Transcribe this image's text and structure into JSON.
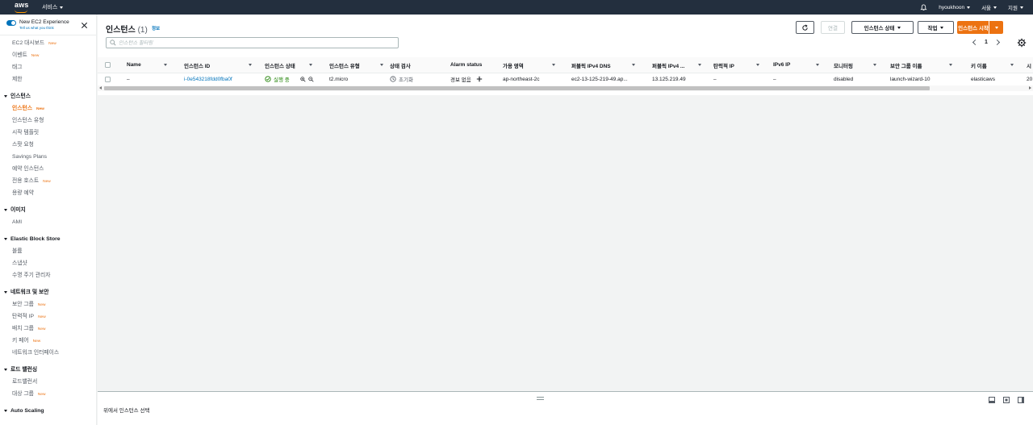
{
  "topnav": {
    "logo_text": "aws",
    "services_label": "서비스",
    "user_label": "hyoukhoon",
    "region_label": "서울",
    "support_label": "지원"
  },
  "sidebar": {
    "experience_title": "New EC2 Experience",
    "experience_sub": "Tell us what you think",
    "groups": [
      {
        "title": null,
        "items": [
          {
            "label": "EC2 대시보드",
            "new": "New",
            "active": false
          },
          {
            "label": "이벤트",
            "new": "New",
            "active": false
          },
          {
            "label": "태그",
            "new": null,
            "active": false
          },
          {
            "label": "제한",
            "new": null,
            "active": false
          }
        ]
      },
      {
        "title": "인스턴스",
        "items": [
          {
            "label": "인스턴스",
            "new": "New",
            "active": true
          },
          {
            "label": "인스턴스 유형",
            "new": null,
            "active": false
          },
          {
            "label": "시작 템플릿",
            "new": null,
            "active": false
          },
          {
            "label": "스팟 요청",
            "new": null,
            "active": false
          },
          {
            "label": "Savings Plans",
            "new": null,
            "active": false
          },
          {
            "label": "예약 인스턴스",
            "new": null,
            "active": false
          },
          {
            "label": "전용 호스트",
            "new": "New",
            "active": false
          },
          {
            "label": "용량 예약",
            "new": null,
            "active": false
          }
        ]
      },
      {
        "title": "이미지",
        "items": [
          {
            "label": "AMI",
            "new": null,
            "active": false
          }
        ]
      },
      {
        "title": "Elastic Block Store",
        "items": [
          {
            "label": "볼륨",
            "new": null,
            "active": false
          },
          {
            "label": "스냅샷",
            "new": null,
            "active": false
          },
          {
            "label": "수명 주기 관리자",
            "new": null,
            "active": false
          }
        ]
      },
      {
        "title": "네트워크 및 보안",
        "items": [
          {
            "label": "보안 그룹",
            "new": "New",
            "active": false
          },
          {
            "label": "탄력적 IP",
            "new": "New",
            "active": false
          },
          {
            "label": "배치 그룹",
            "new": "New",
            "active": false
          },
          {
            "label": "키 페어",
            "new": "New",
            "active": false
          },
          {
            "label": "네트워크 인터페이스",
            "new": null,
            "active": false
          }
        ]
      },
      {
        "title": "로드 밸런싱",
        "items": [
          {
            "label": "로드밸런서",
            "new": null,
            "active": false
          },
          {
            "label": "대상 그룹",
            "new": "New",
            "active": false
          }
        ]
      },
      {
        "title": "Auto Scaling",
        "items": []
      }
    ]
  },
  "main": {
    "title": "인스턴스",
    "count": "(1)",
    "info": "정보",
    "connect_label": "연결",
    "state_label": "인스턴스 상태",
    "actions_label": "작업",
    "launch_label": "인스턴스 시작",
    "search_placeholder": "인스턴스 필터링",
    "page": "1",
    "columns": [
      "Name",
      "인스턴스 ID",
      "인스턴스 상태",
      "인스턴스 유형",
      "상태 검사",
      "Alarm status",
      "가용 영역",
      "퍼블릭 IPv4 DNS",
      "퍼블릭 IPv4 ...",
      "탄력적 IP",
      "IPv6 IP",
      "모니터링",
      "보안 그룹 이름",
      "키 이름",
      "시"
    ],
    "row": {
      "name": "–",
      "instance_id": "i-0e543218fdd0fba0f",
      "state": "실행 중",
      "type": "t2.micro",
      "status_check": "초기화",
      "alarm": "경보 없음",
      "az": "ap-northeast-2c",
      "dns": "ec2-13-125-219-49.ap...",
      "ipv4": "13.125.219.49",
      "eip": "–",
      "ipv6": "–",
      "monitoring": "disabled",
      "sg": "launch-wizard-10",
      "key": "elasticaws",
      "launch": "20"
    }
  },
  "bottom": {
    "text": "위에서 인스턴스 선택"
  },
  "colors": {
    "nav_bg": "#232f3e",
    "accent": "#ec7211",
    "link": "#0073bb",
    "running": "#1d8102"
  }
}
